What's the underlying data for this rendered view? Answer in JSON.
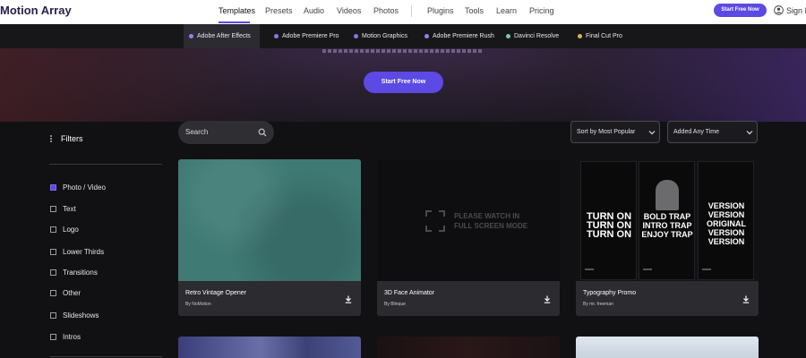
{
  "header": {
    "logo": "Motion Array",
    "nav": [
      "Templates",
      "Presets",
      "Audio",
      "Videos",
      "Photos",
      "Plugins",
      "Tools",
      "Learn",
      "Pricing"
    ],
    "start_free": "Start Free Now",
    "sign_in": "Sign I"
  },
  "subnav": [
    {
      "label": "Adobe After Effects",
      "color": "#9b7bf0"
    },
    {
      "label": "Adobe Premiere Pro",
      "color": "#8f74ef"
    },
    {
      "label": "Motion Graphics",
      "color": "#7f79f3"
    },
    {
      "label": "Adobe Premiere Rush",
      "color": "#a47af0"
    },
    {
      "label": "Davinci Resolve",
      "color": "#7bc7b0"
    },
    {
      "label": "Final Cut Pro",
      "color": "#e2b14b"
    }
  ],
  "hero": {
    "cta": "Start Free Now"
  },
  "filters": {
    "title": "Filters",
    "items": [
      {
        "label": "Photo / Video",
        "checked": true
      },
      {
        "label": "Text",
        "checked": false
      },
      {
        "label": "Logo",
        "checked": false
      },
      {
        "label": "Lower Thirds",
        "checked": false
      },
      {
        "label": "Transitions",
        "checked": false
      },
      {
        "label": "Other",
        "checked": false
      },
      {
        "label": "Slideshows",
        "checked": false
      },
      {
        "label": "Intros",
        "checked": false
      }
    ]
  },
  "search": {
    "placeholder": "Search"
  },
  "sort": {
    "value": "Sort by Most Popular"
  },
  "date": {
    "value": "Added Any Time"
  },
  "cards": [
    {
      "title": "Retro Vintage Opener",
      "author": "By NoMotion",
      "thumb": "teal"
    },
    {
      "title": "3D Face Animator",
      "author": "By Blinque",
      "thumb": "black",
      "overlay": "PLEASE WATCH IN\nFULL SCREEN MODE"
    },
    {
      "title": "Typography Promo",
      "author": "By mr. freeman",
      "thumb": "typo",
      "panel_texts": [
        "TURN ON\nTURN ON\nTURN ON",
        "BOLD TRAP\nINTRO TRAP\nENJOY TRAP",
        "VERSION\nVERSION\nORIGINAL\nVERSION\nVERSION"
      ]
    }
  ],
  "colors": {
    "accent": "#5b4ae3"
  }
}
